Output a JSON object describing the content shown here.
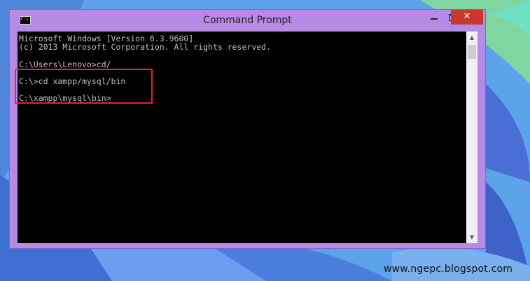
{
  "window": {
    "title": "Command Prompt",
    "icon_text": "C:\\",
    "close_label": "✕"
  },
  "console": {
    "lines": [
      "Microsoft Windows [Version 6.3.9600]",
      "(c) 2013 Microsoft Corporation. All rights reserved.",
      "C:\\Users\\Lenovo>cd/",
      "C:\\>cd xampp/mysql/bin",
      "C:\\xampp\\mysql\\bin>"
    ]
  },
  "scrollbar": {
    "up_arrow": "▲",
    "down_arrow": "▼"
  },
  "watermark": "www.ngepc.blogspot.com",
  "colors": {
    "window_frame": "#b58be6",
    "close_button": "#c7382f",
    "highlight": "#e32b2b",
    "console_bg": "#000000",
    "console_text": "#c0c0c0"
  }
}
